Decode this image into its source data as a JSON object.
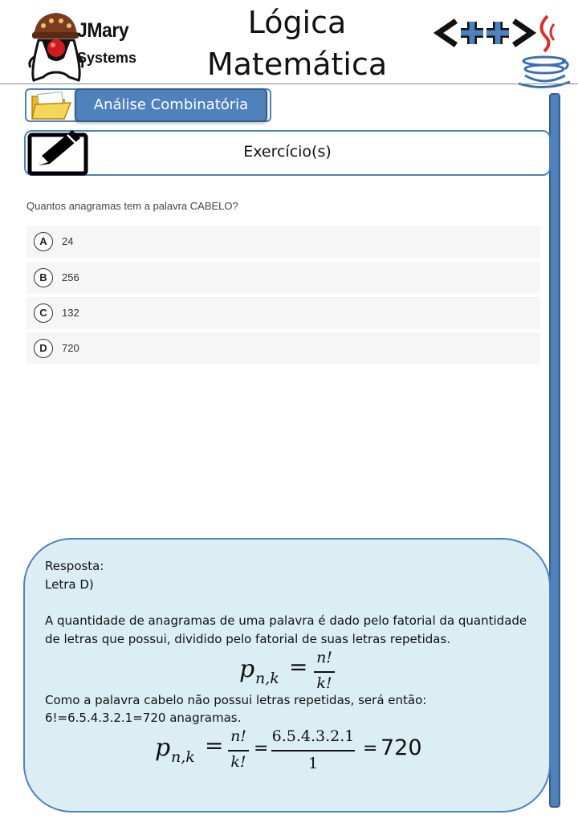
{
  "header": {
    "logo_name": "JMary",
    "logo_sub": "Systems",
    "title_line1": "Lógica",
    "title_line2": "Matemática",
    "right_logo_text": "<++>"
  },
  "section": {
    "label": "Análise Combinatória"
  },
  "exercise": {
    "label": "Exercício(s)"
  },
  "question": {
    "text": "Quantos anagramas tem a palavra CABELO?",
    "options": [
      {
        "letter": "A",
        "text": "24"
      },
      {
        "letter": "B",
        "text": "256"
      },
      {
        "letter": "C",
        "text": "132"
      },
      {
        "letter": "D",
        "text": "720"
      }
    ]
  },
  "answer": {
    "line1": "Resposta:",
    "line2": "Letra D)",
    "para1_line1": "A quantidade de anagramas de uma palavra é dado pelo fatorial da quantidade",
    "para1_line2": "de letras que possui, dividido pelo fatorial de suas letras repetidas.",
    "formula1": {
      "lhs": "p",
      "sub": "n,k",
      "eq": "=",
      "num": "n!",
      "den": "k!"
    },
    "para2_line1": "Como a palavra cabelo não possui letras repetidas, será então:",
    "para2_line2": "6!=6.5.4.3.2.1=720 anagramas.",
    "formula2": {
      "lhs": "p",
      "sub": "n,k",
      "eq": "=",
      "num": "n!",
      "den": "k!",
      "eq2": "=",
      "num2": "6.5.4.3.2.1",
      "den2": "1",
      "eq3": "=",
      "result": "720"
    }
  },
  "colors": {
    "accent": "#4f81bd",
    "accent_dark": "#385d8a",
    "answer_bg": "#dbeef4",
    "option_bg": "#f6f6f6"
  }
}
